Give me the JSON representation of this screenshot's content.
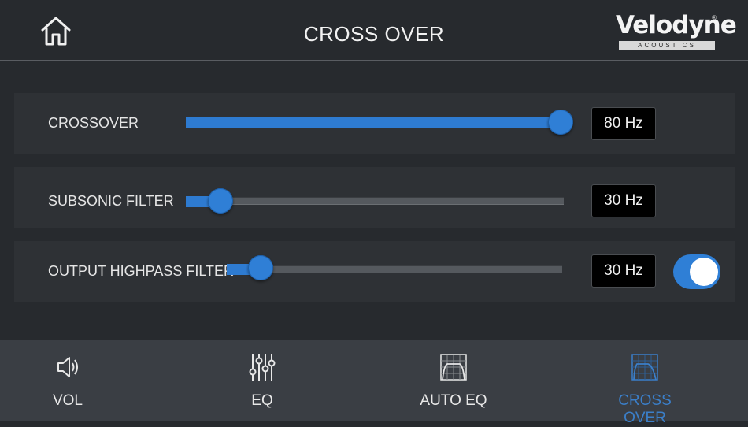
{
  "header": {
    "title": "CROSS OVER",
    "home_icon": "home-icon",
    "logo_text": "Velodyne",
    "logo_sub": "ACOUSTICS",
    "logo_mark": "®"
  },
  "colors": {
    "accent": "#2e7bd1",
    "background": "#272a2e",
    "panel": "#2e3135",
    "nav_background": "#3a3e44",
    "active_nav": "#3b7fc9"
  },
  "rows": [
    {
      "label": "CROSSOVER",
      "value": "80 Hz",
      "level": 1.0
    },
    {
      "label": "SUBSONIC FILTER",
      "value": "30 Hz",
      "level": 0.0
    },
    {
      "label": "OUTPUT HIGHPASS FILTER",
      "value": "30 Hz",
      "level": 0.0,
      "toggle_on": true
    }
  ],
  "nav": [
    {
      "label": "VOL",
      "icon": "speaker-icon",
      "active": false
    },
    {
      "label": "EQ",
      "icon": "eq-sliders-icon",
      "active": false
    },
    {
      "label": "AUTO EQ",
      "icon": "auto-eq-icon",
      "active": false
    },
    {
      "label": "CROSS OVER",
      "icon": "crossover-icon",
      "active": true
    }
  ]
}
